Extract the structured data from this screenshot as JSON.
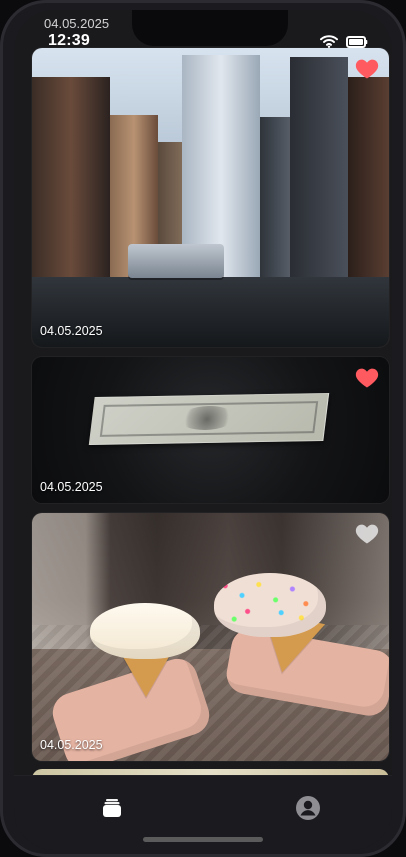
{
  "status_bar": {
    "time": "12:39"
  },
  "feed": {
    "top_ghost_date": "04.05.2025",
    "cards": [
      {
        "date": "04.05.2025",
        "favorite": true
      },
      {
        "date": "04.05.2025",
        "favorite": true
      },
      {
        "date": "04.05.2025",
        "favorite": false
      }
    ]
  },
  "colors": {
    "heart_active": "#FF5A5F",
    "heart_inactive": "#E6E6E6"
  },
  "tabbar": {
    "feed_icon": "stack-icon",
    "profile_icon": "profile-icon"
  }
}
